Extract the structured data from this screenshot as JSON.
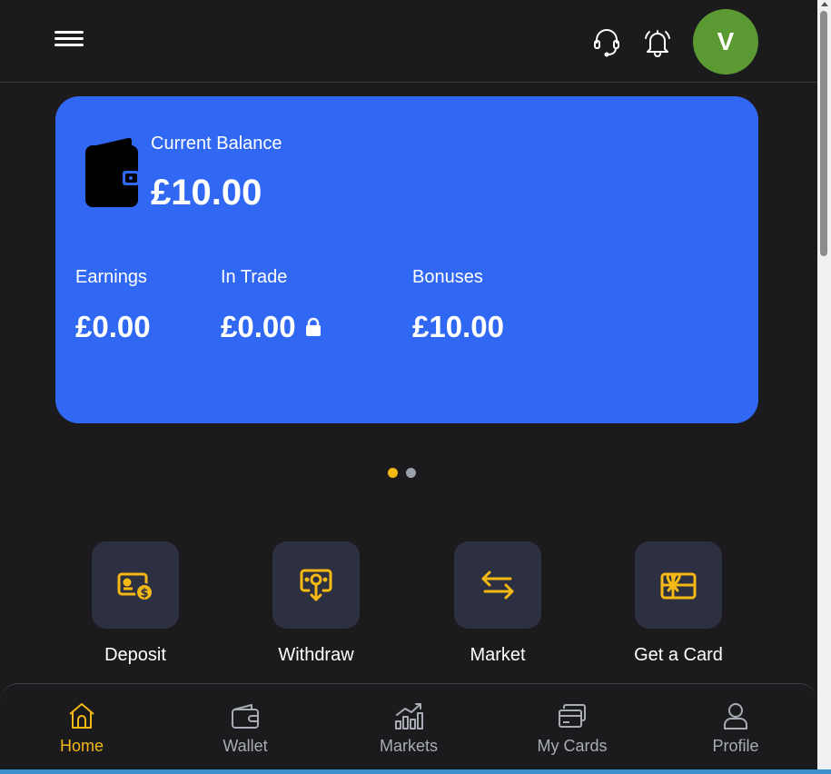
{
  "header": {
    "avatar_initial": "V"
  },
  "balance": {
    "label": "Current Balance",
    "amount": "£10.00",
    "stats": [
      {
        "label": "Earnings",
        "value": "£0.00"
      },
      {
        "label": "In Trade",
        "value": "£0.00"
      },
      {
        "label": "Bonuses",
        "value": "£10.00"
      }
    ]
  },
  "carousel": {
    "pages": 2,
    "active_index": 0
  },
  "actions": [
    {
      "label": "Deposit",
      "icon": "deposit-icon"
    },
    {
      "label": "Withdraw",
      "icon": "withdraw-icon"
    },
    {
      "label": "Market",
      "icon": "exchange-icon"
    },
    {
      "label": "Get a Card",
      "icon": "gift-card-icon"
    }
  ],
  "nav": [
    {
      "label": "Home",
      "icon": "home-icon",
      "active": true
    },
    {
      "label": "Wallet",
      "icon": "wallet-icon",
      "active": false
    },
    {
      "label": "Markets",
      "icon": "chart-icon",
      "active": false
    },
    {
      "label": "My Cards",
      "icon": "cards-icon",
      "active": false
    },
    {
      "label": "Profile",
      "icon": "user-icon",
      "active": false
    }
  ],
  "colors": {
    "background": "#1b1b1d",
    "card_blue": "#3168f3",
    "accent_yellow": "#f5b915",
    "avatar_green": "#5b9a32",
    "tile": "#2d3040"
  }
}
